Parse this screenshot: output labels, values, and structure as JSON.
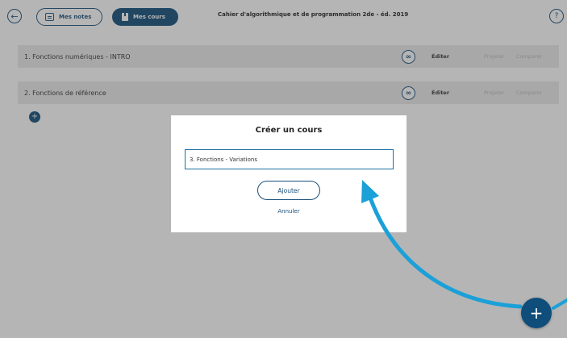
{
  "header": {
    "back_icon": "back-arrow-icon",
    "notes_label": "Mes notes",
    "courses_label": "Mes cours",
    "book_title": "Cahier d'algorithmique et de programmation 2de - éd. 2019",
    "help_label": "?"
  },
  "courses": [
    {
      "title": "1. Fonctions numériques - INTRO",
      "edit": "Éditer",
      "project": "Projeter",
      "compare": "Comparer"
    },
    {
      "title": "2. Fonctions de référence",
      "edit": "Éditer",
      "project": "Projeter",
      "compare": "Comparer"
    }
  ],
  "small_add_label": "+",
  "dialog": {
    "title": "Créer un cours",
    "input_value": "3. Fonctions - Variations",
    "add_label": "Ajouter",
    "cancel_label": "Annuler"
  },
  "fab_label": "+",
  "colors": {
    "primary": "#0f4d7a",
    "accent_arrow": "#1ba0d8",
    "row_bg": "#eaeaea"
  }
}
